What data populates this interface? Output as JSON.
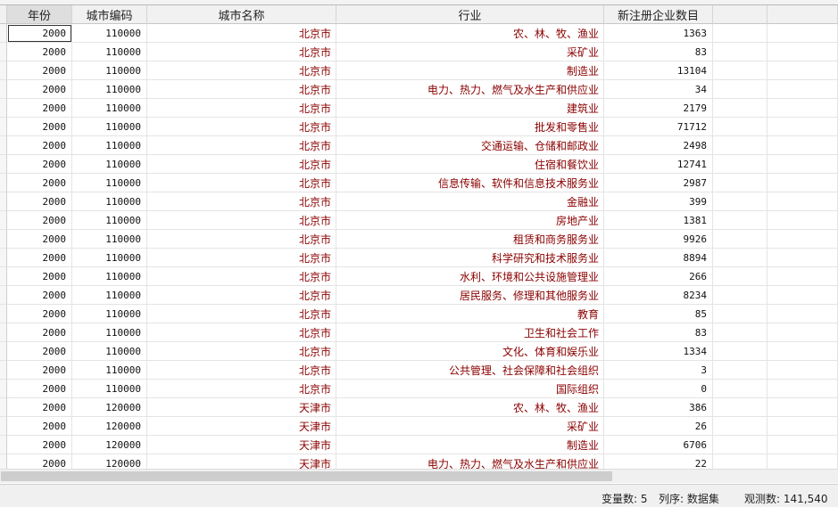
{
  "columns": [
    "年份",
    "城市编码",
    "城市名称",
    "行业",
    "新注册企业数目"
  ],
  "rows": [
    [
      "2000",
      "110000",
      "北京市",
      "农、林、牧、渔业",
      "1363"
    ],
    [
      "2000",
      "110000",
      "北京市",
      "采矿业",
      "83"
    ],
    [
      "2000",
      "110000",
      "北京市",
      "制造业",
      "13104"
    ],
    [
      "2000",
      "110000",
      "北京市",
      "电力、热力、燃气及水生产和供应业",
      "34"
    ],
    [
      "2000",
      "110000",
      "北京市",
      "建筑业",
      "2179"
    ],
    [
      "2000",
      "110000",
      "北京市",
      "批发和零售业",
      "71712"
    ],
    [
      "2000",
      "110000",
      "北京市",
      "交通运输、仓储和邮政业",
      "2498"
    ],
    [
      "2000",
      "110000",
      "北京市",
      "住宿和餐饮业",
      "12741"
    ],
    [
      "2000",
      "110000",
      "北京市",
      "信息传输、软件和信息技术服务业",
      "2987"
    ],
    [
      "2000",
      "110000",
      "北京市",
      "金融业",
      "399"
    ],
    [
      "2000",
      "110000",
      "北京市",
      "房地产业",
      "1381"
    ],
    [
      "2000",
      "110000",
      "北京市",
      "租赁和商务服务业",
      "9926"
    ],
    [
      "2000",
      "110000",
      "北京市",
      "科学研究和技术服务业",
      "8894"
    ],
    [
      "2000",
      "110000",
      "北京市",
      "水利、环境和公共设施管理业",
      "266"
    ],
    [
      "2000",
      "110000",
      "北京市",
      "居民服务、修理和其他服务业",
      "8234"
    ],
    [
      "2000",
      "110000",
      "北京市",
      "教育",
      "85"
    ],
    [
      "2000",
      "110000",
      "北京市",
      "卫生和社会工作",
      "83"
    ],
    [
      "2000",
      "110000",
      "北京市",
      "文化、体育和娱乐业",
      "1334"
    ],
    [
      "2000",
      "110000",
      "北京市",
      "公共管理、社会保障和社会组织",
      "3"
    ],
    [
      "2000",
      "110000",
      "北京市",
      "国际组织",
      "0"
    ],
    [
      "2000",
      "120000",
      "天津市",
      "农、林、牧、渔业",
      "386"
    ],
    [
      "2000",
      "120000",
      "天津市",
      "采矿业",
      "26"
    ],
    [
      "2000",
      "120000",
      "天津市",
      "制造业",
      "6706"
    ],
    [
      "2000",
      "120000",
      "天津市",
      "电力、热力、燃气及水生产和供应业",
      "22"
    ]
  ],
  "status": {
    "variables": "变量数: 5",
    "order": "列序: 数据集",
    "observations": "观测数: 141,540"
  }
}
